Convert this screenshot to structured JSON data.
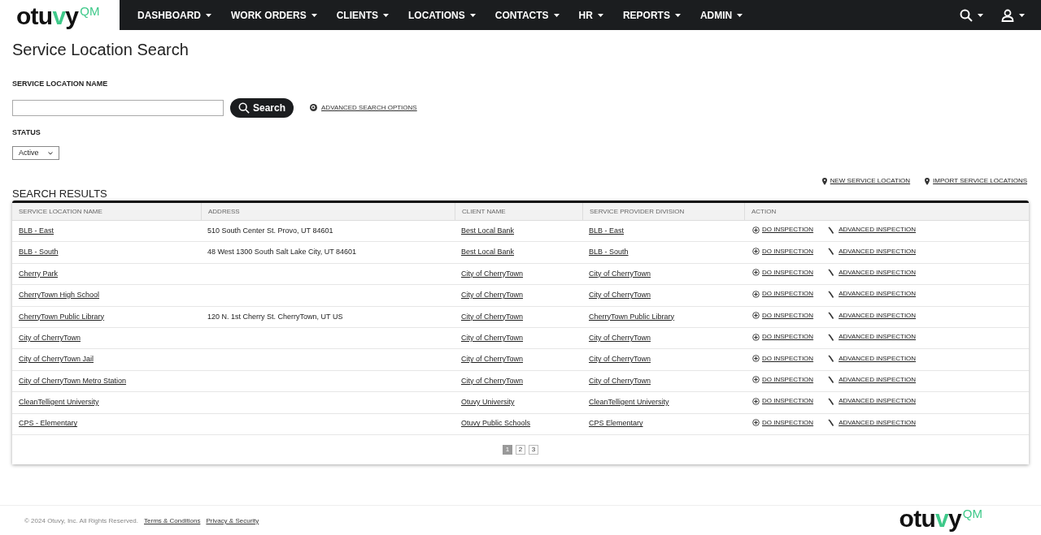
{
  "logo": {
    "word": "otuvy",
    "mark": "QM"
  },
  "nav": {
    "items": [
      "DASHBOARD",
      "WORK ORDERS",
      "CLIENTS",
      "LOCATIONS",
      "CONTACTS",
      "HR",
      "REPORTS",
      "ADMIN"
    ]
  },
  "page_title": "Service Location Search",
  "search": {
    "name_label": "SERVICE LOCATION NAME",
    "button": "Search",
    "advanced_link": "ADVANCED SEARCH OPTIONS",
    "status_label": "STATUS",
    "status_value": "Active"
  },
  "links": [
    "NEW SERVICE LOCATION",
    "IMPORT SERVICE LOCATIONS"
  ],
  "results_title": "SEARCH RESULTS",
  "table": {
    "columns": [
      "SERVICE LOCATION NAME",
      "ADDRESS",
      "CLIENT NAME",
      "SERVICE PROVIDER DIVISION",
      "ACTION"
    ],
    "rows": [
      {
        "name": "BLB - East",
        "address": "510 South Center St. Provo, UT 84601",
        "client": "Best Local Bank",
        "division": "BLB - East",
        "actions": [
          "DO INSPECTION",
          "ADVANCED INSPECTION"
        ]
      },
      {
        "name": "BLB - South",
        "address": "48 West 1300 South Salt Lake City, UT 84601",
        "client": "Best Local Bank",
        "division": "BLB - South",
        "actions": [
          "DO INSPECTION",
          "ADVANCED INSPECTION"
        ]
      },
      {
        "name": "Cherry Park",
        "client": "City of CherryTown",
        "division": "City of CherryTown",
        "actions": [
          "DO INSPECTION",
          "ADVANCED INSPECTION"
        ]
      },
      {
        "name": "CherryTown High School",
        "client": "City of CherryTown",
        "division": "City of CherryTown",
        "actions": [
          "DO INSPECTION",
          "ADVANCED INSPECTION"
        ]
      },
      {
        "name": "CherryTown Public Library",
        "address": "120 N. 1st Cherry St. CherryTown, UT US",
        "client": "City of CherryTown",
        "division": "CherryTown Public Library",
        "actions": [
          "DO INSPECTION",
          "ADVANCED INSPECTION"
        ]
      },
      {
        "name": "City of CherryTown",
        "client": "City of CherryTown",
        "division": "City of CherryTown",
        "actions": [
          "DO INSPECTION",
          "ADVANCED INSPECTION"
        ]
      },
      {
        "name": "City of CherryTown Jail",
        "client": "City of CherryTown",
        "division": "City of CherryTown",
        "actions": [
          "DO INSPECTION",
          "ADVANCED INSPECTION"
        ]
      },
      {
        "name": "City of CherryTown Metro Station",
        "client": "City of CherryTown",
        "division": "City of CherryTown",
        "actions": [
          "DO INSPECTION",
          "ADVANCED INSPECTION"
        ]
      },
      {
        "name": "CleanTelligent University",
        "client": "Otuvy University",
        "division": "CleanTelligent University",
        "actions": [
          "DO INSPECTION",
          "ADVANCED INSPECTION"
        ]
      },
      {
        "name": "CPS - Elementary",
        "client": "Otuvy Public Schools",
        "division": "CPS Elementary",
        "actions": [
          "DO INSPECTION",
          "ADVANCED INSPECTION"
        ]
      }
    ]
  },
  "pagination": [
    {
      "label": "1",
      "selected": true
    },
    {
      "label": "2",
      "selected": false
    },
    {
      "label": "3",
      "selected": false
    }
  ],
  "footer_logo": {
    "word": "otuvy",
    "mark": "QM"
  },
  "footer": {
    "copyright": "© 2024 Otuvy, Inc. All Rights Reserved.",
    "links": [
      "Terms & Conditions",
      "Privacy & Security"
    ]
  }
}
